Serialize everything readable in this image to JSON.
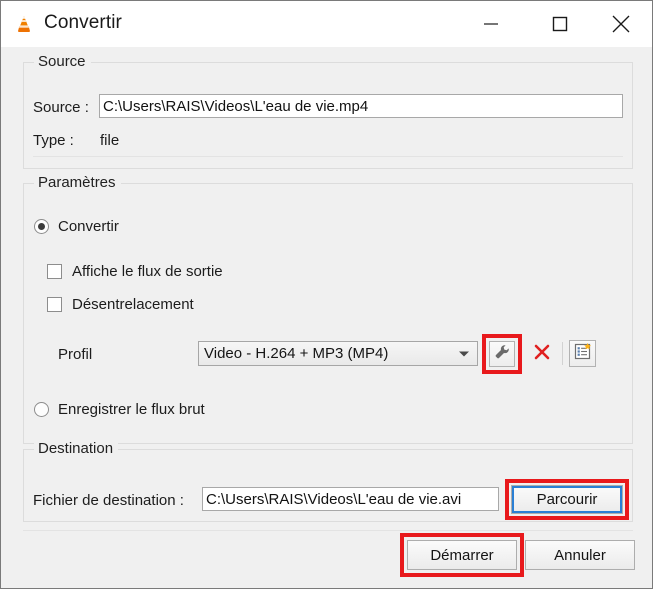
{
  "window": {
    "title": "Convertir",
    "app_icon": "vlc-cone-icon",
    "controls": {
      "minimize": "minimize-icon",
      "maximize": "maximize-icon",
      "close": "close-icon"
    }
  },
  "source": {
    "group_label": "Source",
    "source_label": "Source :",
    "source_value": "C:\\Users\\RAIS\\Videos\\L'eau de vie.mp4",
    "type_label": "Type :",
    "type_value": "file"
  },
  "parameters": {
    "group_label": "Paramètres",
    "convert_radio": "Convertir",
    "convert_selected": true,
    "show_output_checkbox": "Affiche le flux de sortie",
    "show_output_checked": false,
    "deinterlace_checkbox": "Désentrelacement",
    "deinterlace_checked": false,
    "profile_label": "Profil",
    "profile_value": "Video - H.264 + MP3 (MP4)",
    "edit_profile_icon": "wrench-icon",
    "delete_profile_icon": "red-x-icon",
    "new_profile_icon": "new-profile-icon",
    "raw_radio": "Enregistrer le flux brut",
    "raw_selected": false
  },
  "destination": {
    "group_label": "Destination",
    "file_label": "Fichier de destination :",
    "file_value": "C:\\Users\\RAIS\\Videos\\L'eau de vie.avi",
    "browse_button": "Parcourir"
  },
  "footer": {
    "start_button": "Démarrer",
    "cancel_button": "Annuler"
  },
  "annotations": {
    "color": "#e8191c",
    "highlighted": [
      "edit-profile-button",
      "browse-button",
      "start-button"
    ]
  }
}
